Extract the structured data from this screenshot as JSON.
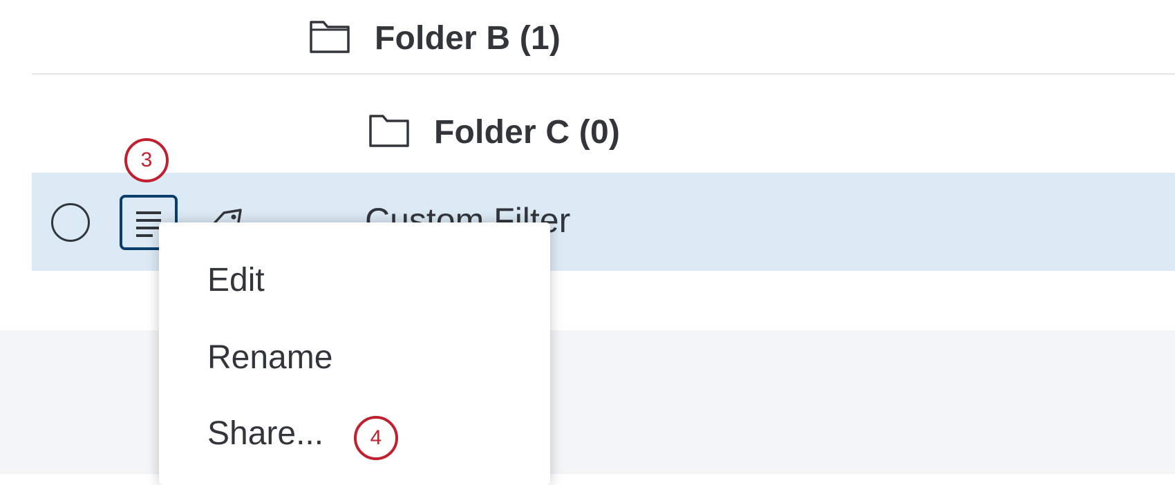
{
  "folders": [
    {
      "label": "Folder B (1)",
      "icon": "folder-icon"
    },
    {
      "label": "Folder C (0)",
      "icon": "folder-icon"
    }
  ],
  "item": {
    "title": "Custom Filter",
    "icons": [
      "radio-button",
      "menu-lines-icon",
      "tag-icon"
    ],
    "selected": true
  },
  "callouts": {
    "step3": "3",
    "step4": "4"
  },
  "context_menu": {
    "items": [
      "Edit",
      "Rename",
      "Share..."
    ]
  },
  "colors": {
    "selected_row": "#dceaf5",
    "callout": "#c0202f",
    "menu_button_border": "#0a3e6b",
    "footer_bg": "#f4f5f6"
  }
}
